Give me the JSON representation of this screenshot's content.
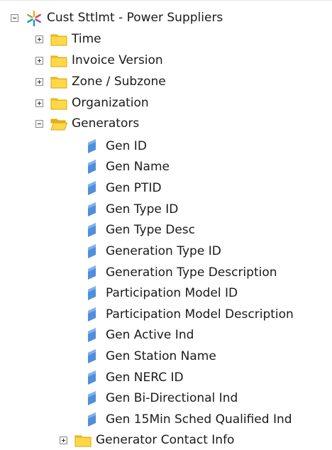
{
  "tree": {
    "root": {
      "label": "Cust Sttlmt - Power Suppliers",
      "icon": "spark-star-icon",
      "expanded": true
    },
    "folders_before": [
      {
        "label": "Time",
        "icon": "folder-icon",
        "expanded": false
      },
      {
        "label": "Invoice Version",
        "icon": "folder-icon",
        "expanded": false
      },
      {
        "label": "Zone / Subzone",
        "icon": "folder-icon",
        "expanded": false
      },
      {
        "label": "Organization",
        "icon": "folder-icon",
        "expanded": false
      }
    ],
    "open_folder": {
      "label": "Generators",
      "icon": "open-folder-icon",
      "expanded": true
    },
    "attributes": [
      "Gen ID",
      "Gen Name",
      "Gen PTID",
      "Gen Type ID",
      "Gen Type Desc",
      "Generation Type ID",
      "Generation Type Description",
      "Participation Model ID",
      "Participation Model Description",
      "Gen Active Ind",
      "Gen Station Name",
      "Gen NERC ID",
      "Gen Bi-Directional Ind",
      "Gen 15Min Sched Qualified Ind"
    ],
    "child_folder": {
      "label": "Generator Contact Info",
      "icon": "folder-icon",
      "expanded": false
    }
  },
  "colors": {
    "folder": "#f3c21a",
    "folder_dark": "#d9a40c",
    "attribute": "#4f8fdc",
    "toggle_border": "#8c8c8c"
  }
}
